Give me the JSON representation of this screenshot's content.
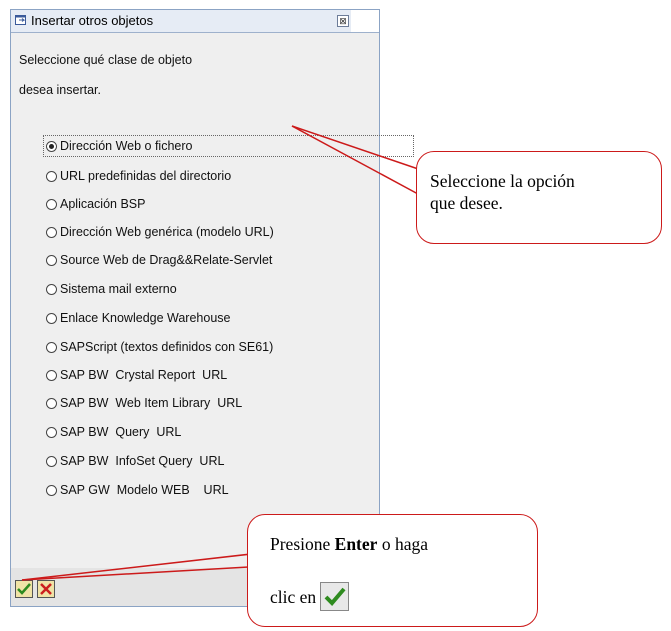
{
  "dialog": {
    "title": "Insertar otros objetos",
    "prompt_line1": "Seleccione qué clase de objeto",
    "prompt_line2": "desea insertar.",
    "options": [
      {
        "label": "Dirección Web o fichero",
        "selected": true
      },
      {
        "label": "URL predefinidas del directorio",
        "selected": false
      },
      {
        "label": "Aplicación BSP",
        "selected": false
      },
      {
        "label": "Dirección Web genérica (modelo URL)",
        "selected": false
      },
      {
        "label": "Source Web de Drag&&Relate-Servlet",
        "selected": false
      },
      {
        "label": "Sistema mail externo",
        "selected": false
      },
      {
        "label": "Enlace Knowledge Warehouse",
        "selected": false
      },
      {
        "label": "SAPScript (textos definidos con SE61)",
        "selected": false
      },
      {
        "label": "SAP BW  Crystal Report  URL",
        "selected": false
      },
      {
        "label": "SAP BW  Web Item Library  URL",
        "selected": false
      },
      {
        "label": "SAP BW  Query  URL",
        "selected": false
      },
      {
        "label": "SAP BW  InfoSet Query  URL",
        "selected": false
      },
      {
        "label": "SAP GW  Modelo WEB    URL",
        "selected": false
      }
    ]
  },
  "callouts": {
    "option_hint_line1": "Seleccione la opción",
    "option_hint_line2": "que desee.",
    "enter_hint_prefix": "Presione ",
    "enter_hint_bold": "Enter",
    "enter_hint_suffix": " o haga",
    "enter_hint_line2": "clic en"
  },
  "colors": {
    "callout_border": "#cc1a1a",
    "dialog_bg": "#efefef",
    "ok_check": "#2e8b1f",
    "cancel_x": "#cc1f1f"
  },
  "icons": {
    "title": "window-icon",
    "close": "close-box-icon",
    "ok": "green-check-icon",
    "cancel": "red-x-icon"
  }
}
